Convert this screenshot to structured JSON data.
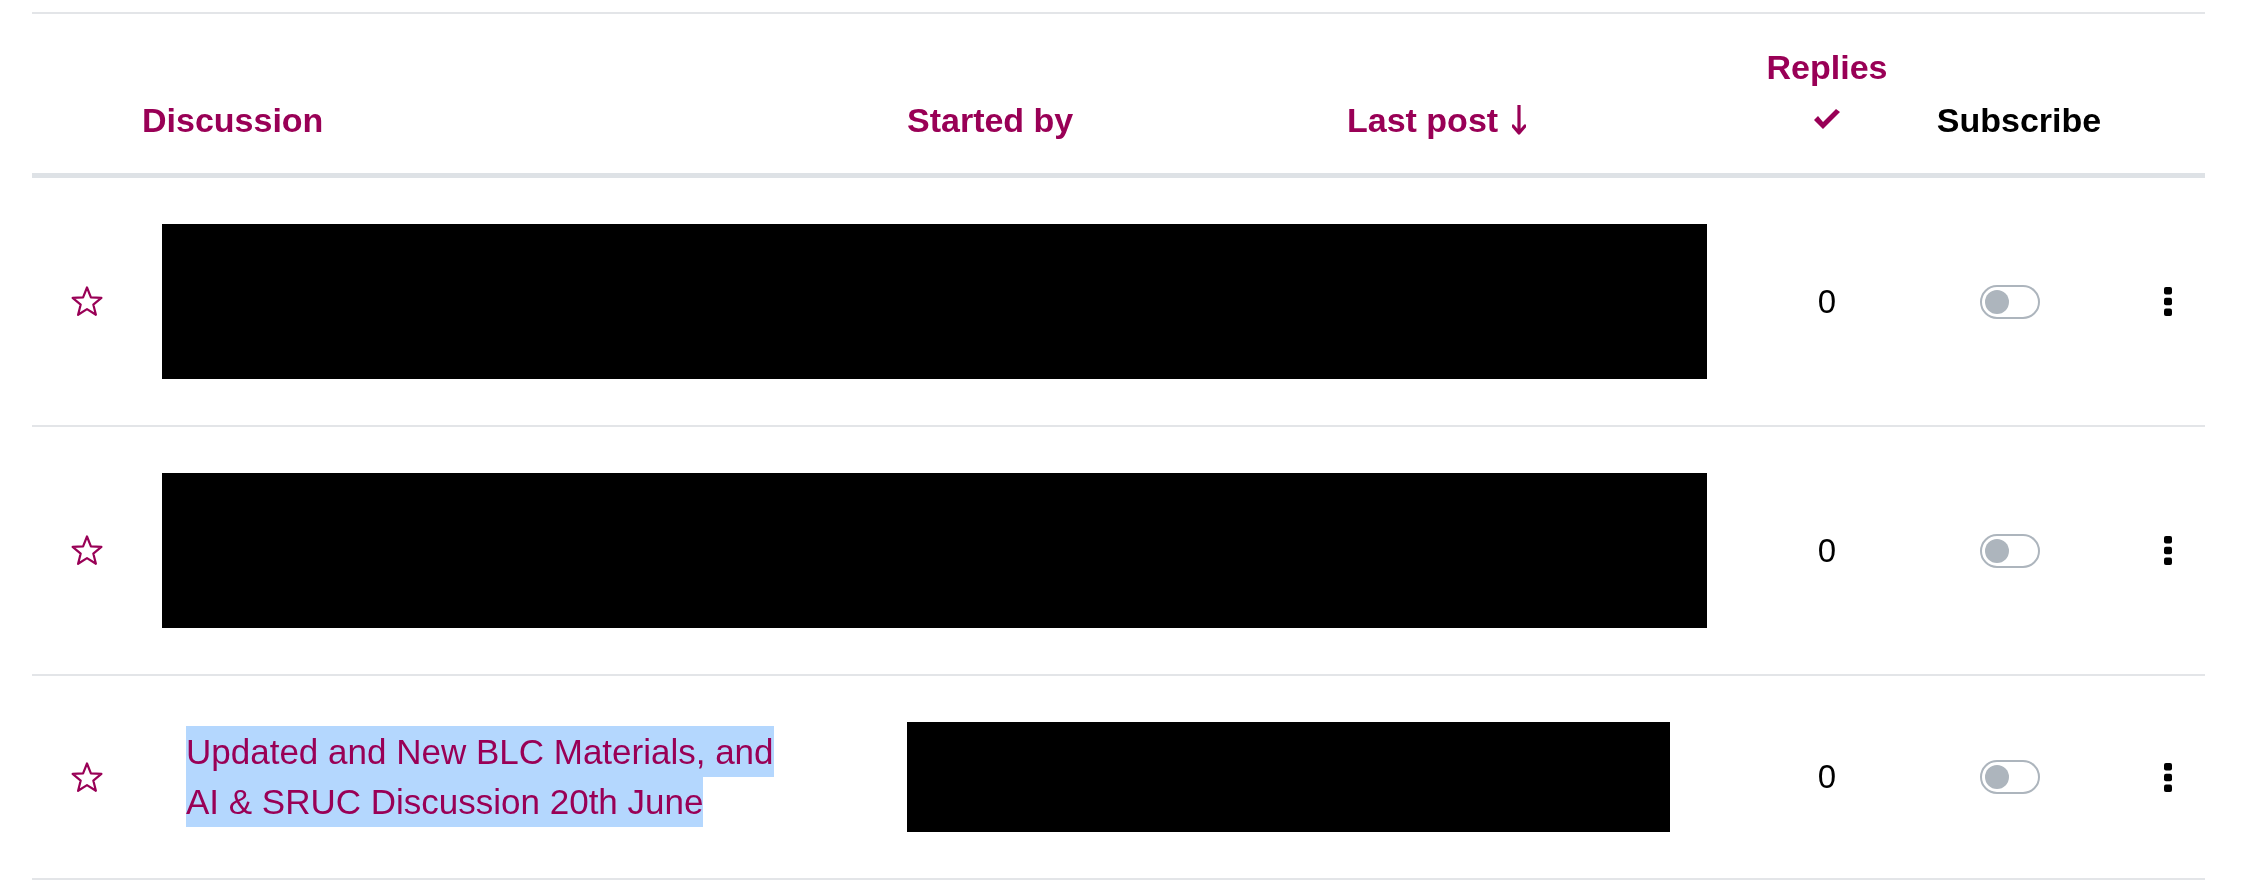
{
  "columns": [
    {
      "label": "Discussion",
      "sortable": true,
      "sorted": false,
      "checked": false
    },
    {
      "label": "Started by",
      "sortable": true,
      "sorted": false,
      "checked": false
    },
    {
      "label": "Last post",
      "sortable": true,
      "sorted": true,
      "checked": false
    },
    {
      "label": "Replies",
      "sortable": true,
      "sorted": false,
      "checked": true
    },
    {
      "label": "Subscribe",
      "sortable": false,
      "sorted": false,
      "checked": false
    }
  ],
  "rows": [
    {
      "kind": "redacted",
      "starred": false,
      "replies": "0",
      "subscribed": false
    },
    {
      "kind": "redacted",
      "starred": false,
      "replies": "0",
      "subscribed": false
    },
    {
      "kind": "partial",
      "starred": false,
      "discussion": "Updated and New BLC Materials, and AI & SRUC Discussion 20th June",
      "highlighted": true,
      "replies": "0",
      "subscribed": false
    }
  ]
}
